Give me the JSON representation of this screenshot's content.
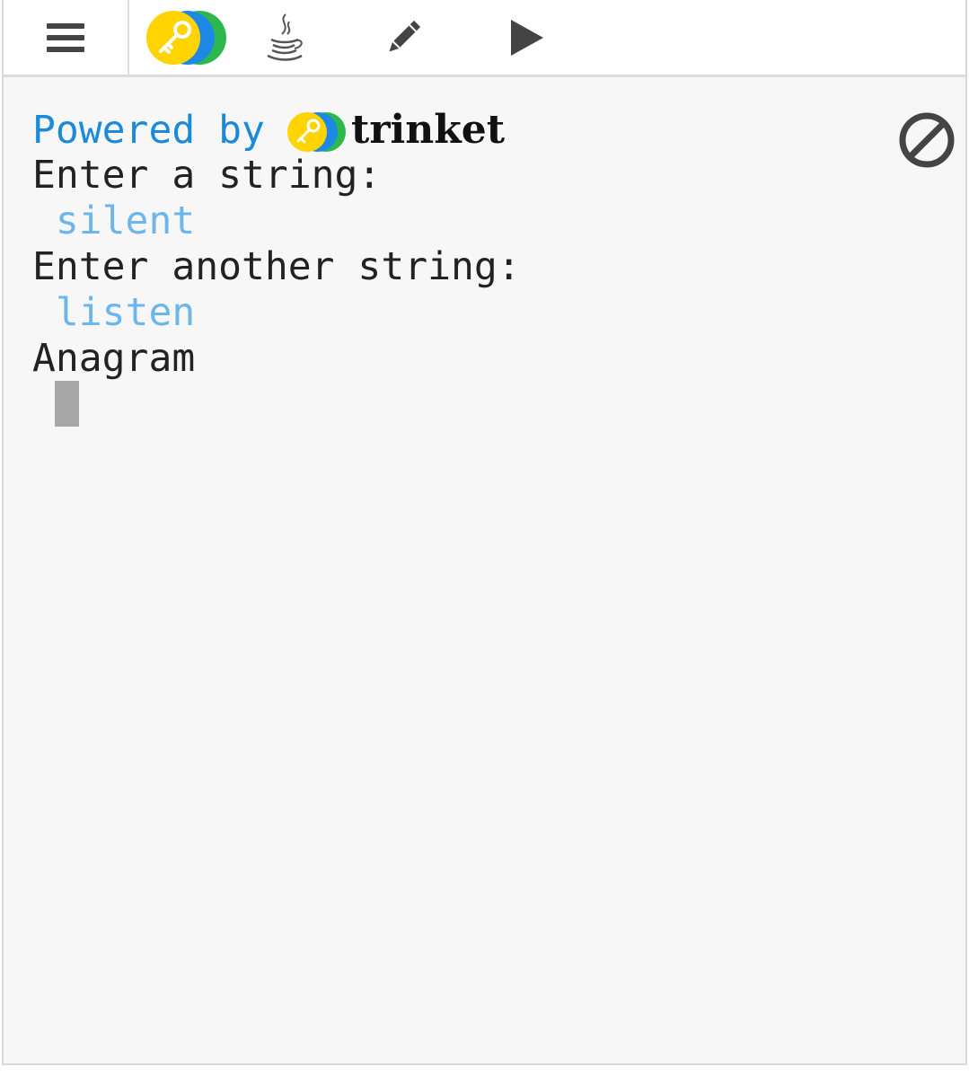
{
  "toolbar": {
    "menu_icon": "hamburger-menu-icon",
    "logo_icon": "trinket-logo-icon",
    "language_icon": "java-coffee-icon",
    "edit_icon": "pencil-icon",
    "run_icon": "play-icon"
  },
  "console": {
    "powered_by_label": "Powered by",
    "brand_name": "trinket",
    "lines": [
      {
        "text": "Enter a string:",
        "kind": "output"
      },
      {
        "text": " silent",
        "kind": "input"
      },
      {
        "text": "Enter another string:",
        "kind": "output"
      },
      {
        "text": " listen",
        "kind": "input"
      },
      {
        "text": "Anagram",
        "kind": "output"
      }
    ],
    "stop_icon": "stop-circle-icon"
  },
  "colors": {
    "powered_blue": "#1a8ad9",
    "input_blue": "#6db6ec",
    "logo_yellow": "#ffd400",
    "logo_blue": "#1e88e5",
    "logo_green": "#2db84d",
    "icon_gray": "#444444"
  }
}
